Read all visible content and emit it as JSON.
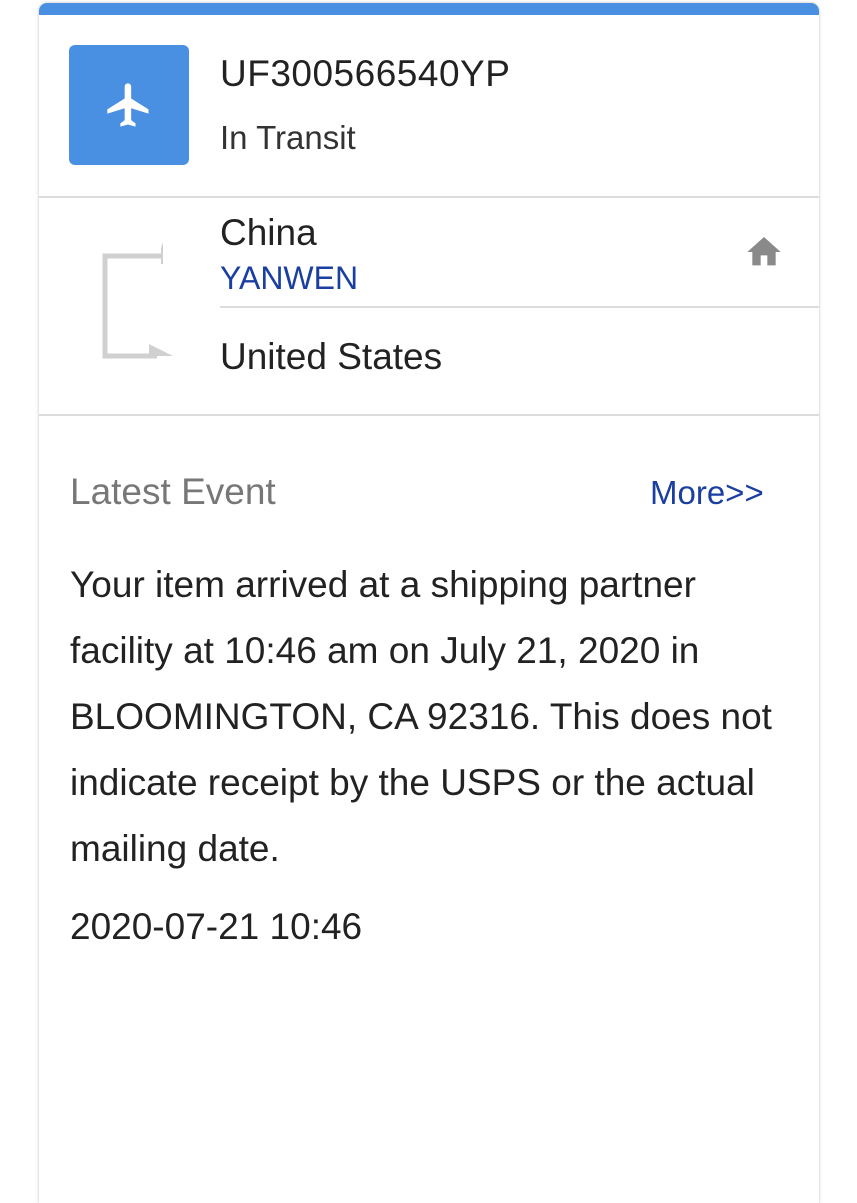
{
  "shipment": {
    "tracking_number": "UF300566540YP",
    "status": "In Transit",
    "status_icon": "airplane-icon",
    "accent_color": "#4a90e2"
  },
  "route": {
    "origin": "China",
    "carrier": "YANWEN",
    "destination": "United States",
    "home_icon": "home-icon"
  },
  "latest_event": {
    "title": "Latest Event",
    "more_label": "More>>",
    "description": "Your item arrived at a shipping partner facility at 10:46 am on July 21, 2020 in BLOOMINGTON, CA 92316. This does not indicate receipt by the USPS or the actual mailing date.",
    "timestamp": "2020-07-21 10:46"
  }
}
